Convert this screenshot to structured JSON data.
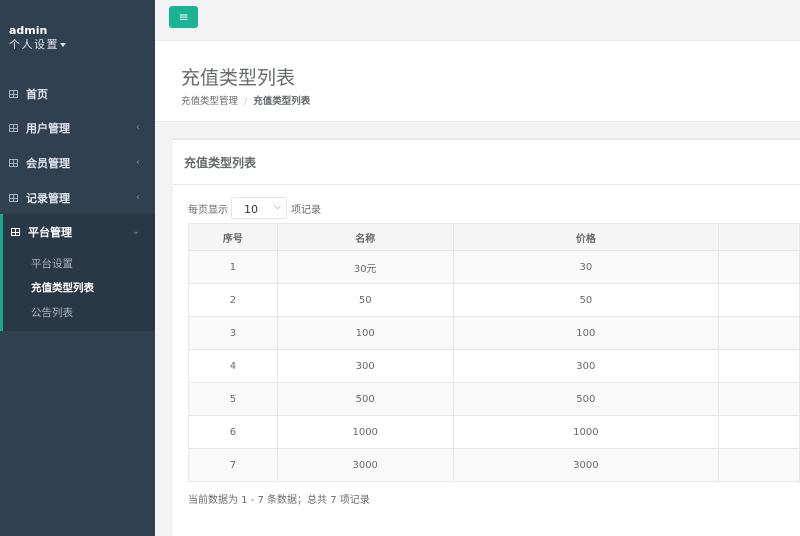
{
  "profile": {
    "user": "admin",
    "settings": "个人设置"
  },
  "nav": {
    "home": "首页",
    "users": "用户管理",
    "members": "会员管理",
    "records": "记录管理",
    "platform": "平台管理",
    "sub": [
      "平台设置",
      "充值类型列表",
      "公告列表"
    ]
  },
  "page": {
    "title": "充值类型列表",
    "breadcrumb": [
      "充值类型管理",
      "充值类型列表"
    ]
  },
  "panel": {
    "title": "充值类型列表",
    "length_prefix": "每页显示",
    "length_value": "10",
    "length_suffix": "项记录",
    "columns": [
      "序号",
      "名称",
      "价格",
      ""
    ],
    "rows": [
      [
        "1",
        "30元",
        "30",
        ""
      ],
      [
        "2",
        "50",
        "50",
        ""
      ],
      [
        "3",
        "100",
        "100",
        ""
      ],
      [
        "4",
        "300",
        "300",
        ""
      ],
      [
        "5",
        "500",
        "500",
        ""
      ],
      [
        "6",
        "1000",
        "1000",
        ""
      ],
      [
        "7",
        "3000",
        "3000",
        ""
      ]
    ],
    "info": "当前数据为 1 - 7 条数据；总共 7 项记录"
  },
  "colors": {
    "sidebar": "#2f4050",
    "accent": "#1ab394"
  }
}
